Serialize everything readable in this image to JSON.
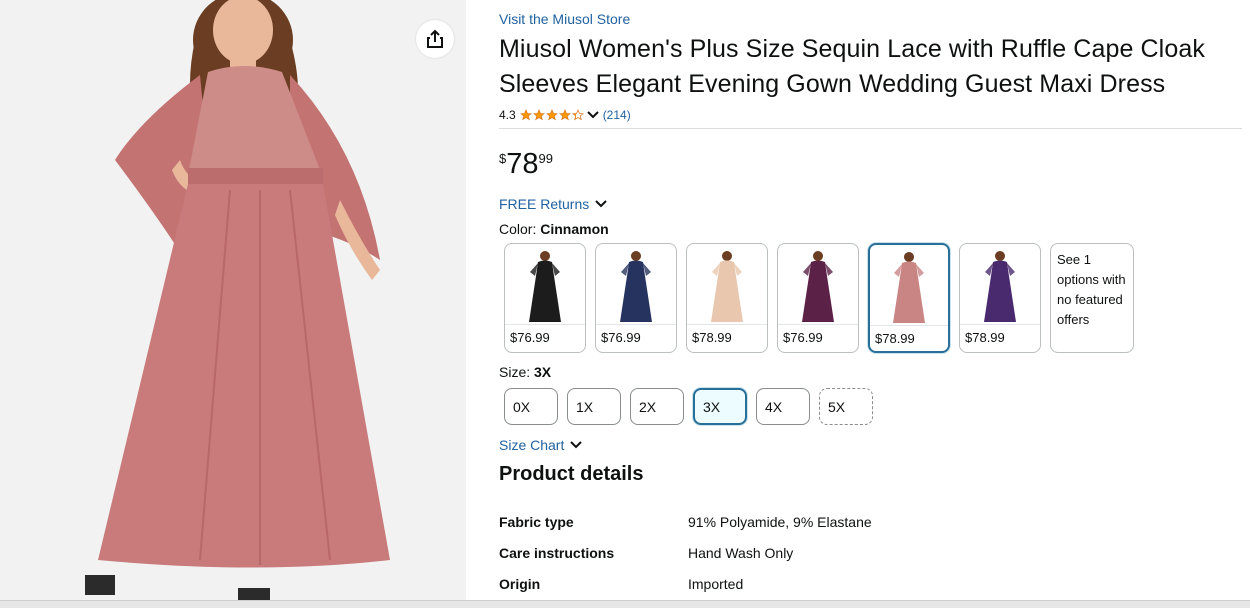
{
  "store_link": "Visit the Miusol Store",
  "title": "Miusol Women's Plus Size Sequin Lace with Ruffle Cape Cloak Sleeves Elegant Evening Gown Wedding Guest Maxi Dress",
  "rating": {
    "value": "4.3",
    "stars": 4.3,
    "count": "(214)"
  },
  "price": {
    "symbol": "$",
    "whole": "78",
    "fraction": "99"
  },
  "free_returns": "FREE Returns",
  "color": {
    "label": "Color:",
    "selected": "Cinnamon",
    "options": [
      {
        "price": "$76.99",
        "color": "#1c1c1c",
        "selected": false
      },
      {
        "price": "$76.99",
        "color": "#26335f",
        "selected": false
      },
      {
        "price": "$78.99",
        "color": "#e9c7ae",
        "selected": false
      },
      {
        "price": "$76.99",
        "color": "#5c2147",
        "selected": false
      },
      {
        "price": "$78.99",
        "color": "#c98484",
        "selected": true
      },
      {
        "price": "$78.99",
        "color": "#4a2a6e",
        "selected": false
      }
    ],
    "more_options": "See 1 options with no featured offers"
  },
  "size": {
    "label": "Size:",
    "selected": "3X",
    "options": [
      "0X",
      "1X",
      "2X",
      "3X",
      "4X",
      "5X"
    ]
  },
  "size_chart": "Size Chart",
  "product_details": {
    "heading": "Product details",
    "rows": [
      {
        "key": "Fabric type",
        "value": "91% Polyamide, 9% Elastane"
      },
      {
        "key": "Care instructions",
        "value": "Hand Wash Only"
      },
      {
        "key": "Origin",
        "value": "Imported"
      }
    ]
  },
  "colors": {
    "link": "#2162a1",
    "star": "#ff9900",
    "selected_border": "#2a6f97",
    "dress": "#c97a7a"
  },
  "icons": {
    "share": "share-icon",
    "chevron": "chevron-down-icon",
    "star": "star-icon"
  }
}
